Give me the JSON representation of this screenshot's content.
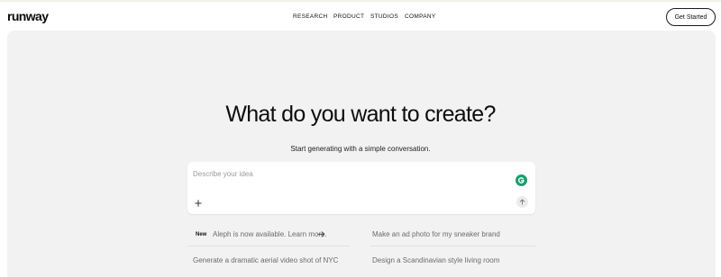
{
  "brand": {
    "logo_text": "runway"
  },
  "nav": {
    "items": [
      {
        "label": "RESEARCH"
      },
      {
        "label": "PRODUCT"
      },
      {
        "label": "STUDIOS"
      },
      {
        "label": "COMPANY"
      }
    ],
    "cta_label": "Get Started"
  },
  "hero": {
    "title": "What do you want to create?",
    "subtitle": "Start generating with a simple conversation."
  },
  "prompt": {
    "placeholder": "Describe your idea",
    "value": ""
  },
  "suggestions": {
    "announcement": {
      "badge": "New",
      "text": "Aleph is now available. Learn more."
    },
    "items": [
      {
        "text": "Make an ad photo for my sneaker brand"
      },
      {
        "text": "Generate a dramatic aerial video shot of NYC"
      },
      {
        "text": "Design a Scandinavian style living room"
      }
    ]
  },
  "icons": {
    "grammarly": "grammarly-icon",
    "plus": "plus-icon",
    "send": "arrow-up-icon",
    "announcement_arrow": "arrow-right-icon"
  },
  "colors": {
    "panel_background": "#f2f2f2",
    "grammarly_green": "#15a06f",
    "text_primary": "#111111",
    "text_muted": "#6b6b6b"
  }
}
